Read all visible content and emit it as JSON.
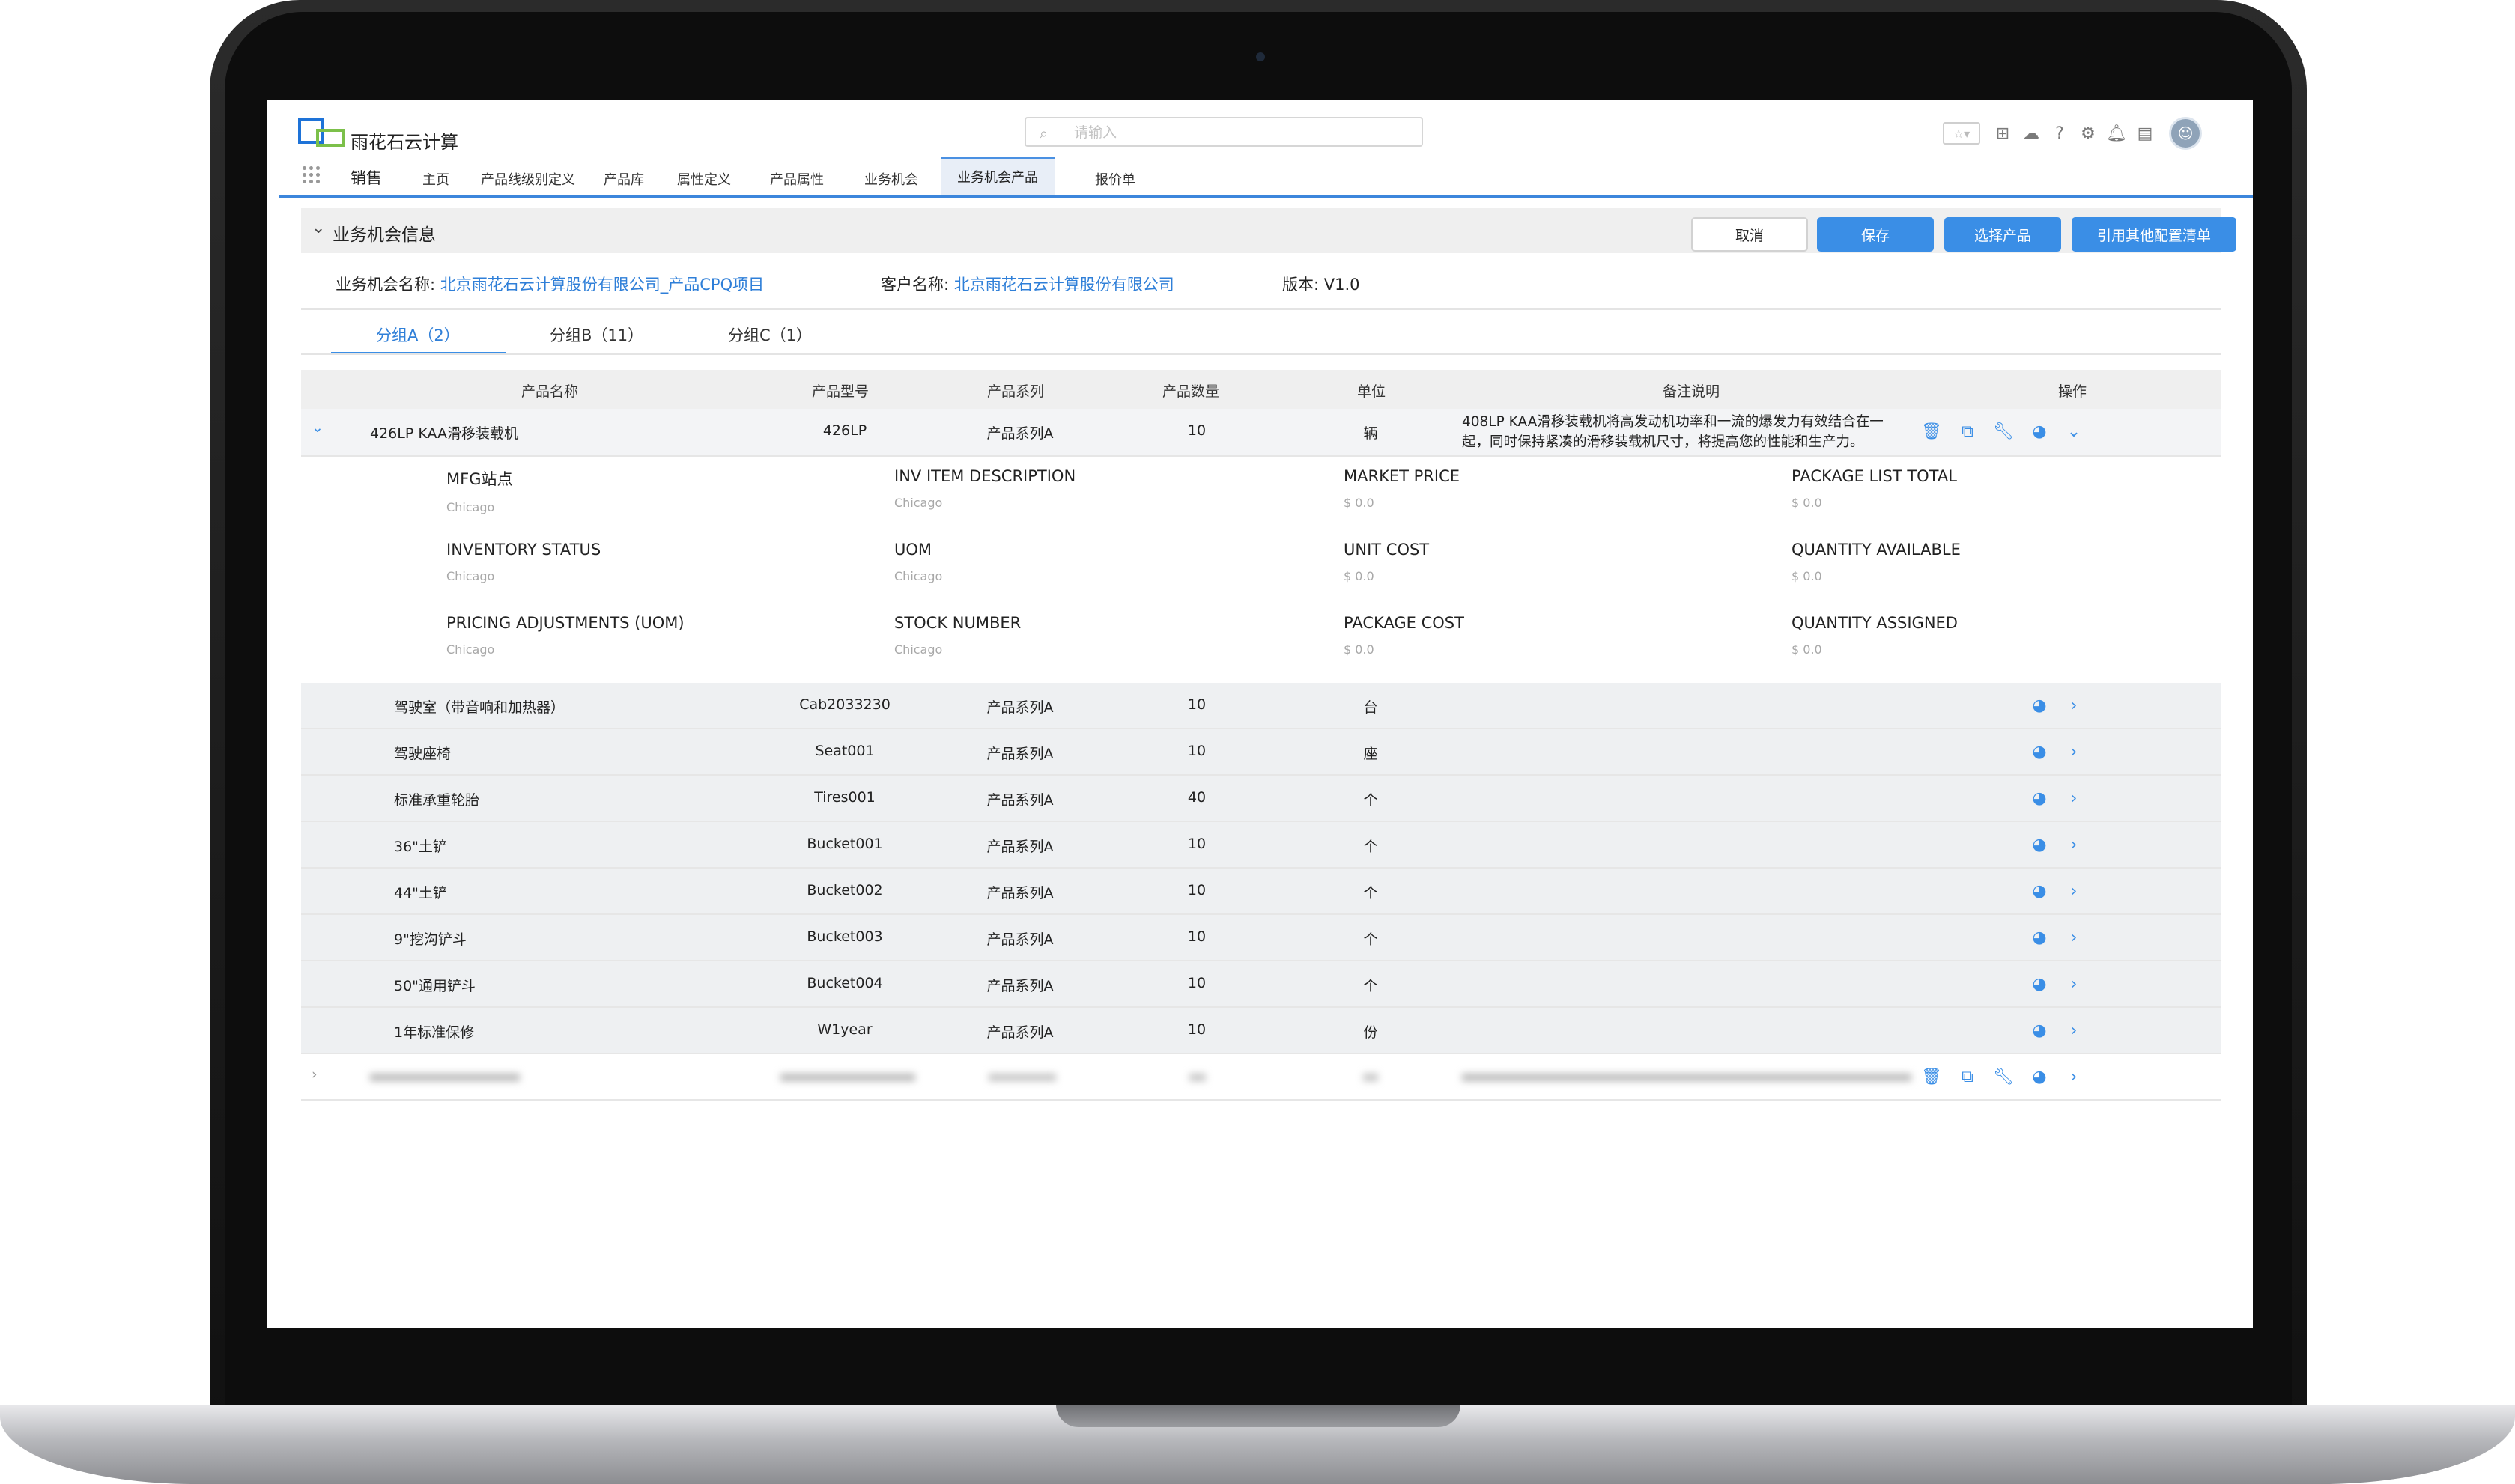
{
  "app": {
    "brand": "雨花石云计算",
    "app_name": "销售",
    "search_placeholder": "请输入",
    "nav_tabs": [
      "主页",
      "产品线级别定义",
      "产品库",
      "属性定义",
      "产品属性",
      "业务机会",
      "业务机会产品",
      "报价单"
    ],
    "active_tab": "业务机会产品"
  },
  "section": {
    "title": "业务机会信息",
    "buttons": {
      "cancel": "取消",
      "save": "保存",
      "select_product": "选择产品",
      "reference": "引用其他配置清单"
    }
  },
  "info": {
    "opportunity_label": "业务机会名称:",
    "opportunity_value": "北京雨花石云计算股份有限公司_产品CPQ项目",
    "customer_label": "客户名称:",
    "customer_value": "北京雨花石云计算股份有限公司",
    "version_label": "版本:",
    "version_value": "V1.0"
  },
  "groups": [
    "分组A（2）",
    "分组B（11）",
    "分组C（1）"
  ],
  "table": {
    "headers": [
      "产品名称",
      "产品型号",
      "产品系列",
      "产品数量",
      "单位",
      "备注说明",
      "操作"
    ],
    "main_row": {
      "name": "426LP KAA滑移装载机",
      "model": "426LP",
      "series": "产品系列A",
      "qty": "10",
      "unit": "辆",
      "note_line1": "408LP KAA滑移装载机将高发动机功率和一流的爆发力有效结合在一",
      "note_line2": "起，同时保持紧凑的滑移装载机尺寸，将提高您的性能和生产力。"
    },
    "detail_fields": [
      {
        "label": "MFG站点",
        "value": "Chicago"
      },
      {
        "label": "INV ITEM DESCRIPTION",
        "value": "Chicago"
      },
      {
        "label": "MARKET PRICE",
        "value": "$ 0.0"
      },
      {
        "label": "PACKAGE LIST TOTAL",
        "value": "$ 0.0"
      },
      {
        "label": "INVENTORY STATUS",
        "value": "Chicago"
      },
      {
        "label": "UOM",
        "value": "Chicago"
      },
      {
        "label": "UNIT COST",
        "value": "$ 0.0"
      },
      {
        "label": "QUANTITY AVAILABLE",
        "value": "$ 0.0"
      },
      {
        "label": "PRICING ADJUSTMENTS (UOM)",
        "value": "Chicago"
      },
      {
        "label": "STOCK NUMBER",
        "value": "Chicago"
      },
      {
        "label": "PACKAGE COST",
        "value": "$ 0.0"
      },
      {
        "label": "QUANTITY ASSIGNED",
        "value": "$ 0.0"
      }
    ],
    "child_rows": [
      {
        "name": "驾驶室（带音响和加热器）",
        "model": "Cab2033230",
        "series": "产品系列A",
        "qty": "10",
        "unit": "台"
      },
      {
        "name": "驾驶座椅",
        "model": "Seat001",
        "series": "产品系列A",
        "qty": "10",
        "unit": "座"
      },
      {
        "name": "标准承重轮胎",
        "model": "Tires001",
        "series": "产品系列A",
        "qty": "40",
        "unit": "个"
      },
      {
        "name": "36\"土铲",
        "model": "Bucket001",
        "series": "产品系列A",
        "qty": "10",
        "unit": "个"
      },
      {
        "name": "44\"土铲",
        "model": "Bucket002",
        "series": "产品系列A",
        "qty": "10",
        "unit": "个"
      },
      {
        "name": "9\"挖沟铲斗",
        "model": "Bucket003",
        "series": "产品系列A",
        "qty": "10",
        "unit": "个"
      },
      {
        "name": "50\"通用铲斗",
        "model": "Bucket004",
        "series": "产品系列A",
        "qty": "10",
        "unit": "个"
      },
      {
        "name": "1年标准保修",
        "model": "W1year",
        "series": "产品系列A",
        "qty": "10",
        "unit": "份"
      }
    ]
  }
}
